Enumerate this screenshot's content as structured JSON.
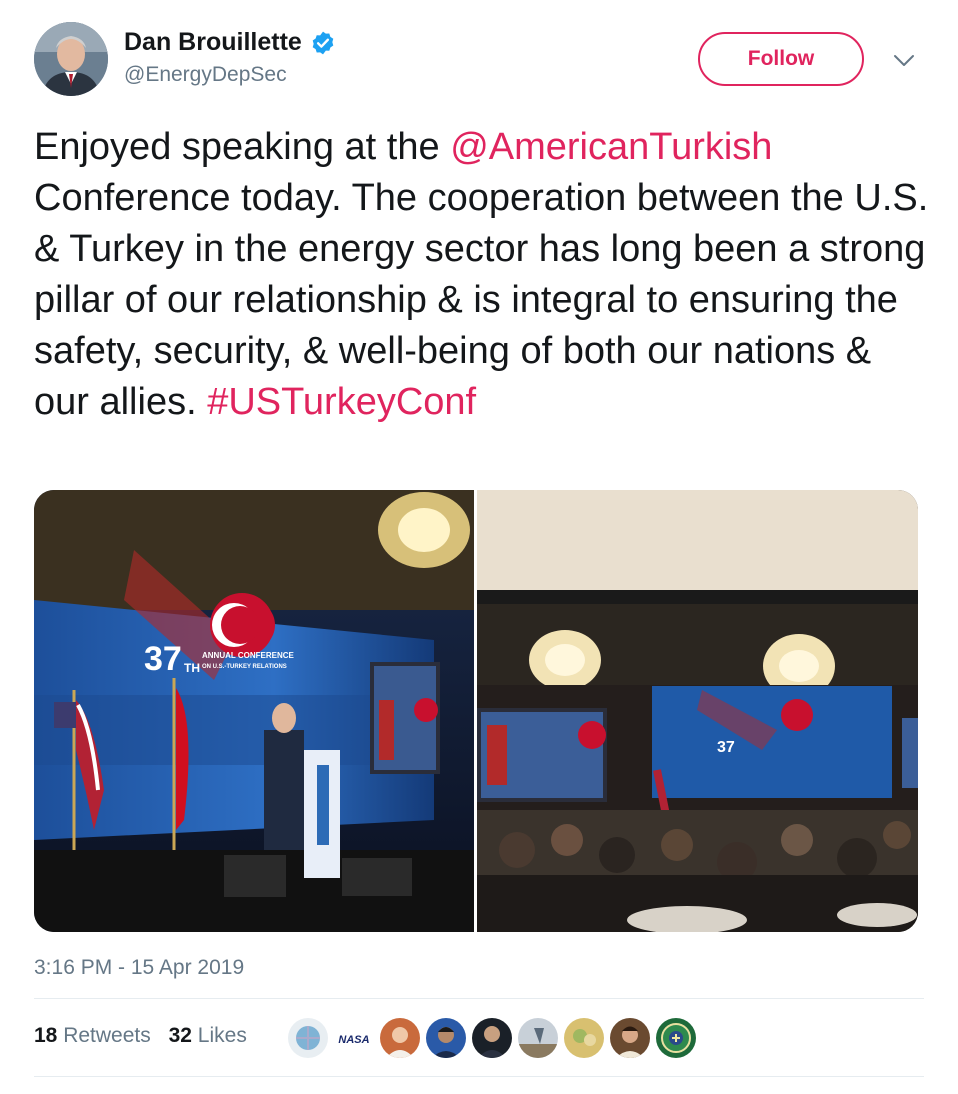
{
  "author": {
    "display_name": "Dan Brouillette",
    "handle": "@EnergyDepSec",
    "verified": true,
    "avatar_icon": "profile-photo"
  },
  "actions": {
    "follow_label": "Follow",
    "menu_icon": "chevron-down-icon"
  },
  "tweet": {
    "text_part1": "Enjoyed speaking at the ",
    "mention": "@AmericanTurkish",
    "text_part2": " Conference today. The cooperation between the U.S. & Turkey in the energy sector has long been a strong pillar of our relationship & is integral to ensuring the safety, security, & well-being of both our nations & our allies. ",
    "hashtag": "#USTurkeyConf"
  },
  "media": {
    "photos": [
      {
        "description_icon": "conference-stage-photo"
      },
      {
        "description_icon": "conference-banquet-photo"
      }
    ],
    "banner_number": "37",
    "banner_suffix": "TH",
    "banner_line1": "ANNUAL CONFERENCE",
    "banner_line2": "ON U.S.-TURKEY RELATIONS"
  },
  "timestamp": "3:16 PM - 15 Apr 2019",
  "stats": {
    "retweets_count": "18",
    "retweets_label": "Retweets",
    "likes_count": "32",
    "likes_label": "Likes"
  },
  "likers": [
    {
      "icon": "liker-avatar-1"
    },
    {
      "icon": "nasa-logo",
      "text": "NASA"
    },
    {
      "icon": "liker-avatar-3"
    },
    {
      "icon": "liker-avatar-4"
    },
    {
      "icon": "liker-avatar-5"
    },
    {
      "icon": "liker-avatar-6"
    },
    {
      "icon": "liker-avatar-7"
    },
    {
      "icon": "liker-avatar-8"
    },
    {
      "icon": "energy-seal-avatar"
    }
  ],
  "colors": {
    "accent": "#e0245e",
    "verified": "#1da1f2",
    "secondary_text": "#657786"
  }
}
